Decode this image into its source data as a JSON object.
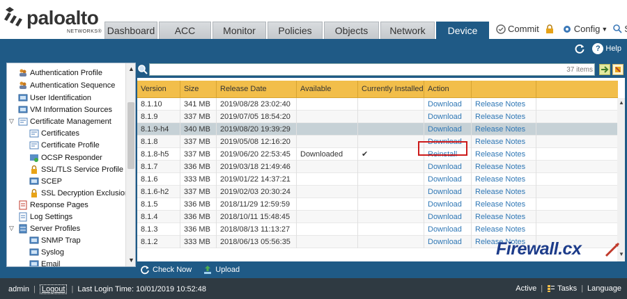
{
  "brand": {
    "name": "paloalto",
    "sub": "NETWORKS®"
  },
  "tabs": [
    {
      "label": "Dashboard",
      "active": false
    },
    {
      "label": "ACC",
      "active": false
    },
    {
      "label": "Monitor",
      "active": false
    },
    {
      "label": "Policies",
      "active": false
    },
    {
      "label": "Objects",
      "active": false
    },
    {
      "label": "Network",
      "active": false
    },
    {
      "label": "Device",
      "active": true
    }
  ],
  "header_tools": {
    "commit": "Commit",
    "config": "Config",
    "search": "Se"
  },
  "band": {
    "help": "Help"
  },
  "sidebar": {
    "items": [
      {
        "label": "Authentication Profile",
        "icon": "user-group-icon"
      },
      {
        "label": "Authentication Sequence",
        "icon": "user-group-icon"
      },
      {
        "label": "User Identification",
        "icon": "screen-icon"
      },
      {
        "label": "VM Information Sources",
        "icon": "screen-icon"
      },
      {
        "label": "Certificate Management",
        "icon": "certificate-icon"
      },
      {
        "label": "Certificates",
        "icon": "certificate-icon"
      },
      {
        "label": "Certificate Profile",
        "icon": "certificate-icon"
      },
      {
        "label": "OCSP Responder",
        "icon": "ocsp-icon"
      },
      {
        "label": "SSL/TLS Service Profile",
        "icon": "lock-icon"
      },
      {
        "label": "SCEP",
        "icon": "screen-icon"
      },
      {
        "label": "SSL Decryption Exclusion",
        "icon": "lock-icon"
      },
      {
        "label": "Response Pages",
        "icon": "page-icon"
      },
      {
        "label": "Log Settings",
        "icon": "page-icon"
      },
      {
        "label": "Server Profiles",
        "icon": "server-icon"
      },
      {
        "label": "SNMP Trap",
        "icon": "screen-icon"
      },
      {
        "label": "Syslog",
        "icon": "screen-icon"
      },
      {
        "label": "Email",
        "icon": "screen-icon"
      }
    ]
  },
  "search": {
    "placeholder": "",
    "count": "37 items"
  },
  "table": {
    "columns": [
      "Version",
      "Size",
      "Release Date",
      "Available",
      "Currently Installed",
      "Action",
      ""
    ],
    "rows": [
      {
        "version": "8.1.10",
        "size": "341 MB",
        "date": "2019/08/28 23:02:40",
        "available": "",
        "installed": "",
        "action": "Download",
        "notes": "Release Notes"
      },
      {
        "version": "8.1.9",
        "size": "337 MB",
        "date": "2019/07/05 18:54:20",
        "available": "",
        "installed": "",
        "action": "Download",
        "notes": "Release Notes"
      },
      {
        "version": "8.1.9-h4",
        "size": "340 MB",
        "date": "2019/08/20 19:39:29",
        "available": "",
        "installed": "",
        "action": "Download",
        "notes": "Release Notes"
      },
      {
        "version": "8.1.8",
        "size": "337 MB",
        "date": "2019/05/08 12:16:20",
        "available": "",
        "installed": "",
        "action": "Download",
        "notes": "Release Notes"
      },
      {
        "version": "8.1.8-h5",
        "size": "337 MB",
        "date": "2019/06/20 22:53:45",
        "available": "Downloaded",
        "installed": "✔",
        "action": "Reinstall",
        "notes": "Release Notes"
      },
      {
        "version": "8.1.7",
        "size": "336 MB",
        "date": "2019/03/18 21:49:46",
        "available": "",
        "installed": "",
        "action": "Download",
        "notes": "Release Notes"
      },
      {
        "version": "8.1.6",
        "size": "333 MB",
        "date": "2019/01/22 14:37:21",
        "available": "",
        "installed": "",
        "action": "Download",
        "notes": "Release Notes"
      },
      {
        "version": "8.1.6-h2",
        "size": "337 MB",
        "date": "2019/02/03 20:30:24",
        "available": "",
        "installed": "",
        "action": "Download",
        "notes": "Release Notes"
      },
      {
        "version": "8.1.5",
        "size": "336 MB",
        "date": "2018/11/29 12:59:59",
        "available": "",
        "installed": "",
        "action": "Download",
        "notes": "Release Notes"
      },
      {
        "version": "8.1.4",
        "size": "336 MB",
        "date": "2018/10/11 15:48:45",
        "available": "",
        "installed": "",
        "action": "Download",
        "notes": "Release Notes"
      },
      {
        "version": "8.1.3",
        "size": "336 MB",
        "date": "2018/08/13 11:13:27",
        "available": "",
        "installed": "",
        "action": "Download",
        "notes": "Release Notes"
      },
      {
        "version": "8.1.2",
        "size": "333 MB",
        "date": "2018/06/13 05:56:35",
        "available": "",
        "installed": "",
        "action": "Download",
        "notes": "Release Notes"
      }
    ]
  },
  "actions": {
    "check_now": "Check Now",
    "upload": "Upload"
  },
  "footer": {
    "user": "admin",
    "logout": "Logout",
    "last_login": "Last Login Time: 10/01/2019 10:52:48",
    "active": "Active",
    "tasks": "Tasks",
    "language": "Language"
  },
  "watermark": "Firewall.cx",
  "colors": {
    "accent": "#1f5a86",
    "header_row": "#f2be4a",
    "link": "#2f77b5",
    "highlight": "#cc1a1a"
  }
}
